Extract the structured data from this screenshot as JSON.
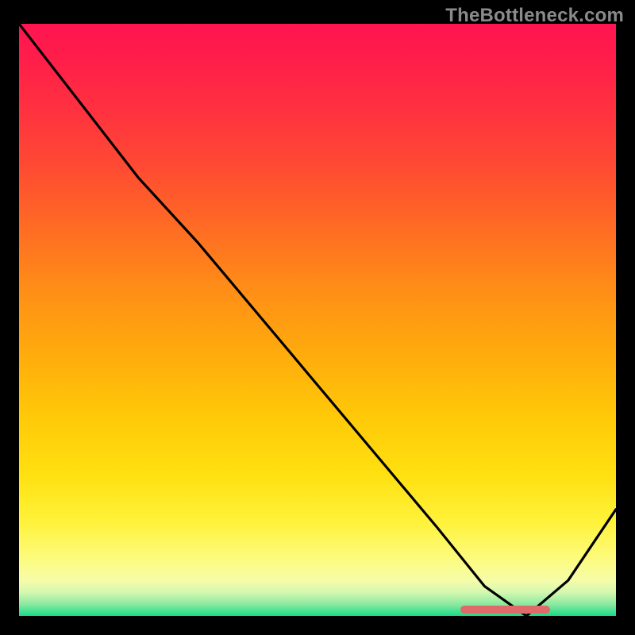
{
  "watermark": "TheBottleneck.com",
  "colors": {
    "page_bg": "#000000",
    "watermark": "#8a8a8a",
    "curve": "#000000",
    "marker": "#e06a6a"
  },
  "chart_data": {
    "type": "line",
    "title": "",
    "xlabel": "",
    "ylabel": "",
    "xlim": [
      0,
      100
    ],
    "ylim": [
      0,
      100
    ],
    "grid": false,
    "legend": false,
    "series": [
      {
        "name": "curve",
        "x": [
          0,
          10,
          20,
          30,
          40,
          50,
          60,
          70,
          78,
          85,
          92,
          100
        ],
        "y": [
          100,
          87,
          74,
          63,
          51,
          39,
          27,
          15,
          5,
          0,
          6,
          18
        ]
      }
    ],
    "marker": {
      "x_start": 74,
      "x_end": 89,
      "y": 0.5
    },
    "annotations": []
  }
}
